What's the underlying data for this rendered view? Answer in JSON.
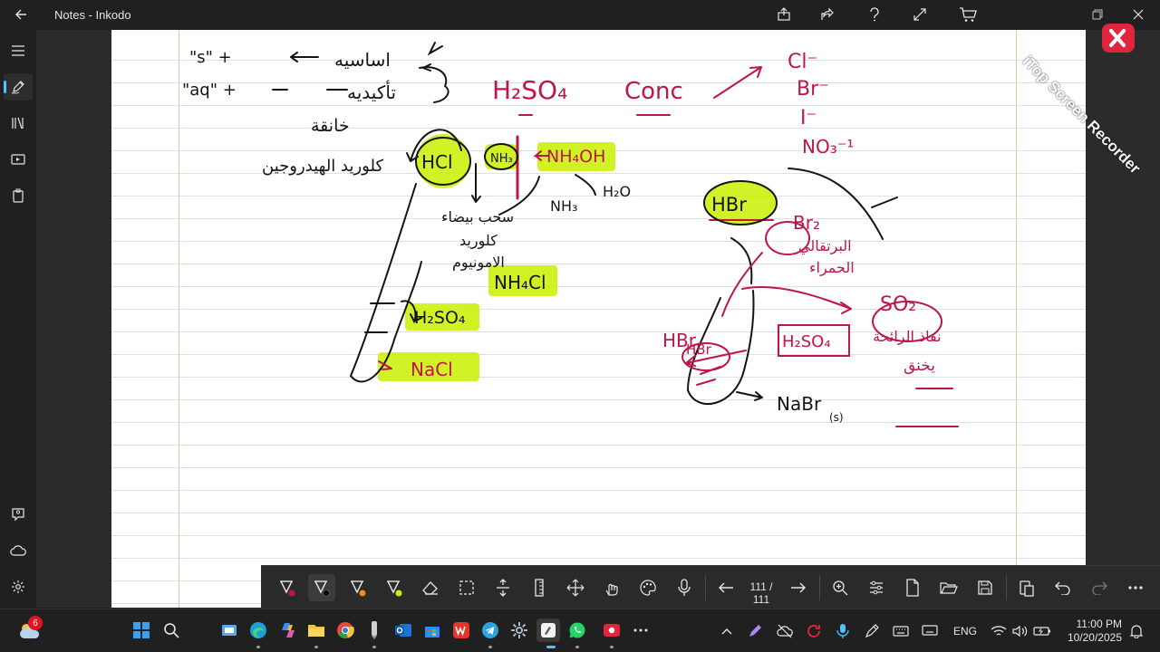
{
  "window": {
    "title": "Notes - Inkodo"
  },
  "toolbar": {
    "page_counter": "111 / 111"
  },
  "watermark": {
    "text": "iTop Screen Recorder"
  },
  "ink_text": {
    "h2so4_top": "H₂SO₄",
    "conc": "Conc",
    "cl": "Cl⁻",
    "br": "Br⁻",
    "i": "I⁻",
    "no3": "NO₃⁻¹",
    "s_plus": "\"s\" +",
    "aq": "\"aq\" +",
    "asasiya": "اساسيه",
    "takidiya": "تأكيديه",
    "khanqa": "خانقة",
    "hcl_name": "كلوريد الهيدروجين",
    "hcl": "HCl",
    "nh3_small": "NH₃",
    "nh4oh": "NH₄OH",
    "nh3_label": "NH₃",
    "h2o": "H₂O",
    "smoke": "سحب بيضاء",
    "chloride": "كلوريد",
    "ammonium": "الامونيوم",
    "nh4cl": "NH₄Cl",
    "h2so4_left": "H₂SO₄",
    "nacl": "NaCl",
    "hbr_circle": "HBr",
    "br2": "Br₂",
    "orange": "البرتقالي",
    "red": "الحمراء",
    "so2": "SO₂",
    "naffadh": "نفاذ الرائحة",
    "khanq": "يخنق",
    "hbr_left": "HBr",
    "hbr_tube": "HBr",
    "h2so4_right": "H₂SO₄",
    "nabr": "NaBr",
    "s_sub": "(s)"
  },
  "taskbar": {
    "weather_badge": "6",
    "language": "ENG",
    "time": "11:00 PM",
    "date": "10/20/2025"
  },
  "colors": {
    "ink_black": "#141414",
    "ink_crimson": "#c0154a",
    "highlighter": "#c8f000",
    "accent": "#4cc2ff"
  }
}
